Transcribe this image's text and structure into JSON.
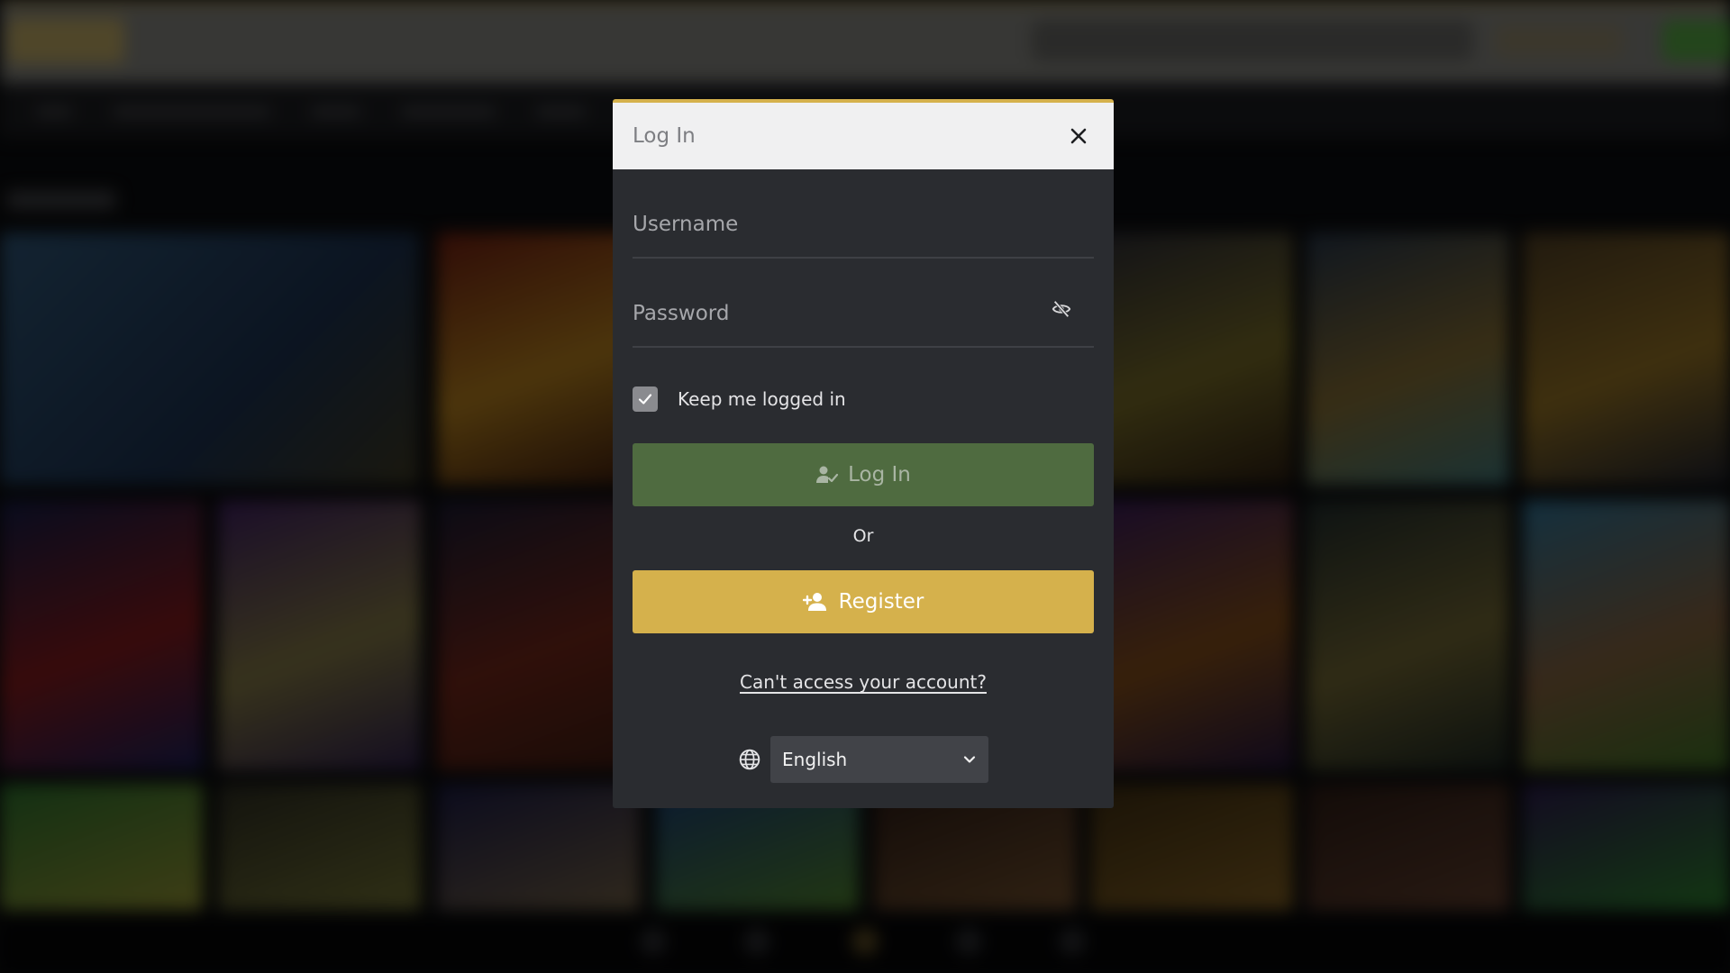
{
  "modal": {
    "title": "Log In",
    "username_placeholder": "Username",
    "password_placeholder": "Password",
    "remember_label": "Keep me logged in",
    "remember_checked": true,
    "login_button": "Log In",
    "or_text": "Or",
    "register_button": "Register",
    "forgot_link": "Can't access your account?",
    "language": "English"
  },
  "colors": {
    "accent": "#d5b14c",
    "login_button": "#4f6b40",
    "modal_background": "#2a2c30",
    "header_background": "#f0f0f1"
  },
  "icons": {
    "close": "close-icon",
    "password_toggle": "eye-off-icon",
    "checkbox": "check-icon",
    "login": "user-check-icon",
    "register": "user-plus-icon",
    "language": "globe-icon",
    "dropdown": "chevron-down-icon"
  }
}
